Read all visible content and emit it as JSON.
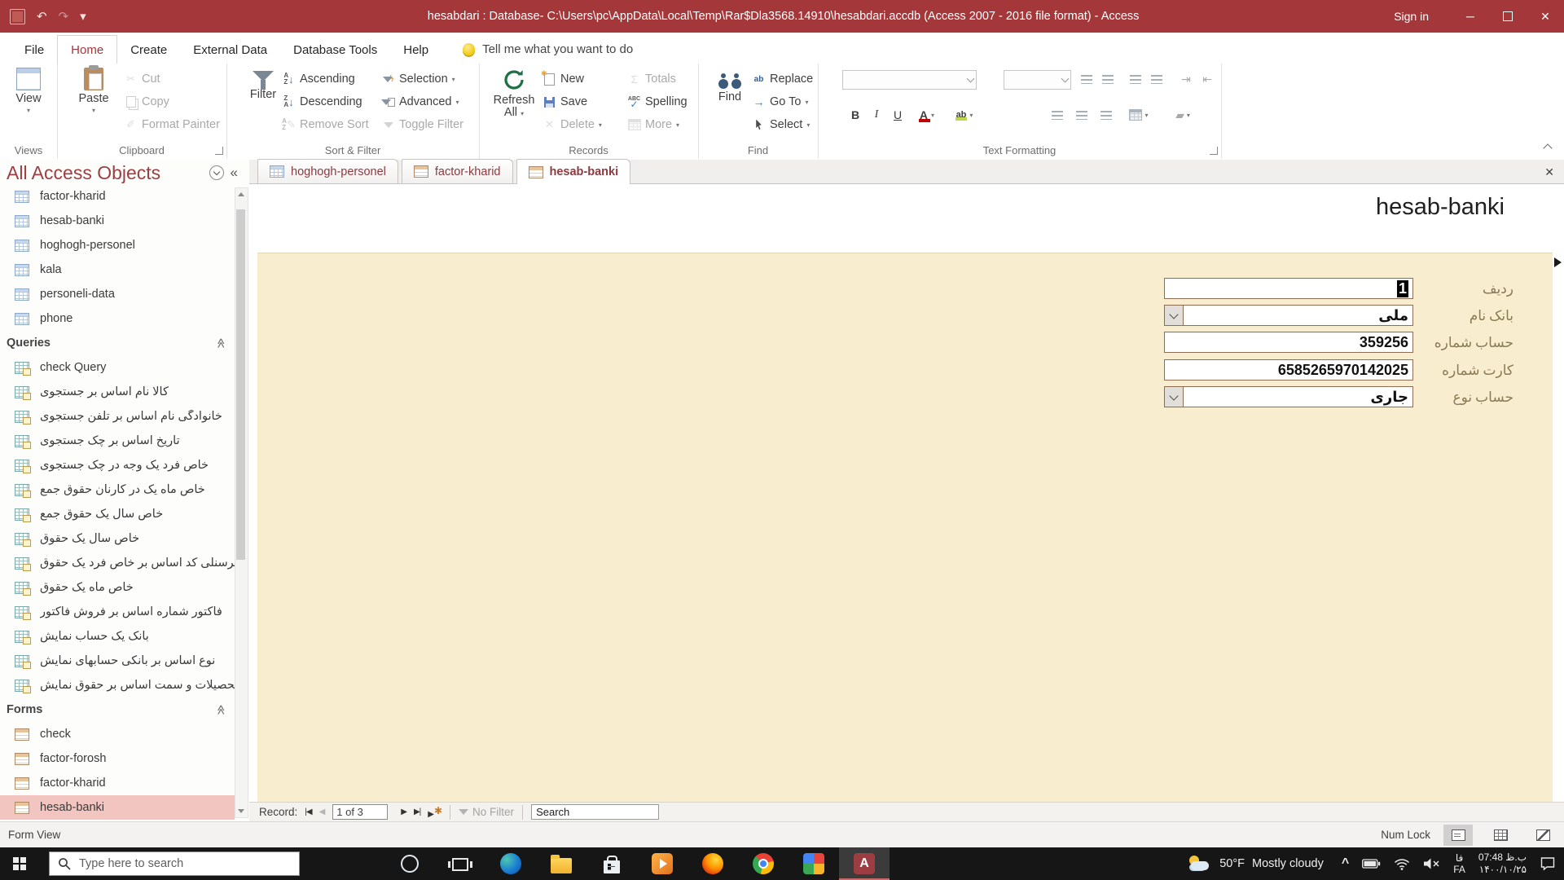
{
  "title_bar": {
    "title": "hesabdari : Database- C:\\Users\\pc\\AppData\\Local\\Temp\\Rar$Dla3568.14910\\hesabdari.accdb (Access 2007 - 2016 file format) -  Access",
    "sign_in": "Sign in"
  },
  "menu_bar": {
    "tabs": [
      "File",
      "Home",
      "Create",
      "External Data",
      "Database Tools",
      "Help"
    ],
    "active_tab": "Home",
    "tell_me": "Tell me what you want to do"
  },
  "ribbon": {
    "views": {
      "group_label": "Views",
      "view": "View"
    },
    "clipboard": {
      "group_label": "Clipboard",
      "paste": "Paste",
      "cut": "Cut",
      "copy": "Copy",
      "format_painter": "Format Painter"
    },
    "sort_filter": {
      "group_label": "Sort & Filter",
      "filter": "Filter",
      "ascending": "Ascending",
      "descending": "Descending",
      "remove_sort": "Remove Sort",
      "selection": "Selection",
      "advanced": "Advanced",
      "toggle_filter": "Toggle Filter"
    },
    "records": {
      "group_label": "Records",
      "refresh_line1": "Refresh",
      "refresh_line2": "All",
      "new": "New",
      "save": "Save",
      "delete": "Delete",
      "totals": "Totals",
      "spelling": "Spelling",
      "more": "More"
    },
    "find": {
      "group_label": "Find",
      "find": "Find",
      "replace": "Replace",
      "go_to": "Go To",
      "select": "Select"
    },
    "text_formatting": {
      "group_label": "Text Formatting"
    }
  },
  "nav_pane": {
    "header": "All Access Objects",
    "tables": [
      "factor-kharid",
      "hesab-banki",
      "hoghogh-personel",
      "kala",
      "personeli-data",
      "phone"
    ],
    "queries_label": "Queries",
    "queries": [
      "check Query",
      "جستجوی بر اساس نام کالا",
      "جستجوی تلفن بر اساس نام خانوادگی",
      "جستجوی چک بر اساس تاریخ",
      "جستجوی چک در وجه یک فرد خاص",
      "جمع حقوق کارنان در یک ماه خاص",
      "جمع حقوق یک سال خاص",
      "حقوق یک سال خاص",
      "حقوق یک فرد خاص بر اساس کد پرسنلی",
      "حقوق یک ماه خاص",
      "فاکتور فروش بر اساس شماره فاکتور",
      "نمایش حساب یک بانک",
      "نمایش حسابهای بانکی بر اساس نوع",
      "نمایش حقوق بر اساس سمت و تحصیلات"
    ],
    "forms_label": "Forms",
    "forms": [
      "check",
      "factor-forosh",
      "factor-kharid",
      "hesab-banki"
    ],
    "selected_form": "hesab-banki"
  },
  "doc_tabs": [
    {
      "label": "hoghogh-personel",
      "icon": "table",
      "active": false
    },
    {
      "label": "factor-kharid",
      "icon": "form",
      "active": false
    },
    {
      "label": "hesab-banki",
      "icon": "form",
      "active": true
    }
  ],
  "form_view": {
    "title": "hesab-banki",
    "fields": [
      {
        "label": "ردیف",
        "value": "1",
        "type": "text",
        "selected": true
      },
      {
        "label": "نام بانک",
        "value": "ملی",
        "type": "combo",
        "selected": false
      },
      {
        "label": "شماره حساب",
        "value": "359256",
        "type": "text",
        "selected": false
      },
      {
        "label": "شماره کارت",
        "value": "6585265970142025",
        "type": "text",
        "selected": false
      },
      {
        "label": "نوع حساب",
        "value": "جاری",
        "type": "combo",
        "selected": false
      }
    ]
  },
  "record_nav": {
    "label": "Record:",
    "position": "1 of 3",
    "no_filter": "No Filter",
    "search": "Search"
  },
  "status_bar": {
    "view_name": "Form View",
    "num_lock": "Num Lock"
  },
  "taskbar": {
    "search_placeholder": "Type here to search",
    "pinned_apps": [
      "cortana",
      "task-view",
      "edge",
      "file-explorer",
      "store",
      "media-player",
      "firefox",
      "chrome",
      "photos",
      "access"
    ],
    "active_app": "access",
    "weather_temp": "50°F",
    "weather_desc": "Mostly cloudy",
    "language_primary": "فا",
    "language_secondary": "FA",
    "time": "07:48 ب.ظ",
    "date": "۱۴۰۰/۱۰/۲۵"
  }
}
